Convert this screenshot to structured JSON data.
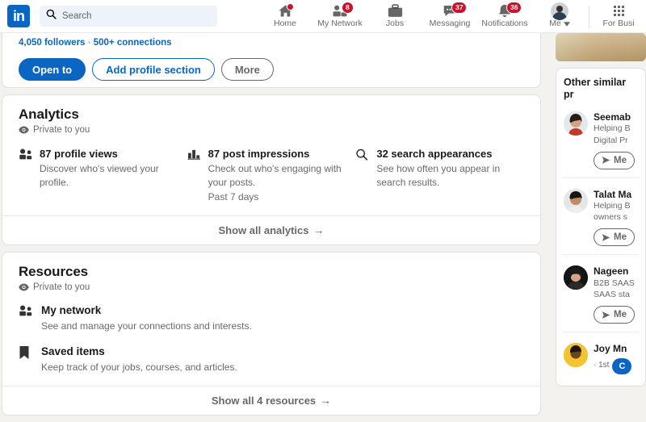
{
  "nav": {
    "logo_text": "in",
    "search_placeholder": "Search",
    "search_value": "",
    "items": [
      {
        "label": "Home",
        "icon": "home-icon",
        "badge": "",
        "badge_type": "dot"
      },
      {
        "label": "My Network",
        "icon": "network-icon",
        "badge": "8",
        "badge_type": "count"
      },
      {
        "label": "Jobs",
        "icon": "briefcase-icon",
        "badge": "",
        "badge_type": "none"
      },
      {
        "label": "Messaging",
        "icon": "message-icon",
        "badge": "37",
        "badge_type": "count"
      },
      {
        "label": "Notifications",
        "icon": "bell-icon",
        "badge": "36",
        "badge_type": "count"
      }
    ],
    "me_label": "Me",
    "business_label": "For Busi"
  },
  "profile": {
    "followers": "4,050 followers",
    "separator": "·",
    "connections": "500+ connections",
    "open_to_label": "Open to",
    "add_section_label": "Add profile section",
    "more_label": "More"
  },
  "analytics": {
    "title": "Analytics",
    "private_label": "Private to you",
    "stats": [
      {
        "icon": "people-icon",
        "title": "87 profile views",
        "desc": "Discover who's viewed your profile.",
        "meta": ""
      },
      {
        "icon": "bar-chart-icon",
        "title": "87 post impressions",
        "desc": "Check out who's engaging with your posts.",
        "meta": "Past 7 days"
      },
      {
        "icon": "search-icon",
        "title": "32 search appearances",
        "desc": "See how often you appear in search results.",
        "meta": ""
      }
    ],
    "show_all_label": "Show all analytics",
    "arrow": "→"
  },
  "resources": {
    "title": "Resources",
    "private_label": "Private to you",
    "items": [
      {
        "icon": "people-icon",
        "title": "My network",
        "desc": "See and manage your connections and interests."
      },
      {
        "icon": "bookmark-icon",
        "title": "Saved items",
        "desc": "Keep track of your jobs, courses, and articles."
      }
    ],
    "show_all_label": "Show all 4 resources",
    "arrow": "→"
  },
  "similar": {
    "heading": "Other similar pr",
    "message_label": "Me",
    "connect_label": "C",
    "people": [
      {
        "name": "Seemab",
        "line1": "Helping B",
        "line2": "Digital Pr",
        "degree": "",
        "action": "message",
        "avatar_bg": "#e3e9ee",
        "hair": "#2b1d15",
        "skin": "#d9a183",
        "shirt": "#c0392b"
      },
      {
        "name": "Talat Ma",
        "line1": "Helping B",
        "line2": "owners s",
        "degree": "",
        "action": "message",
        "avatar_bg": "#e6e6e6",
        "hair": "#181410",
        "skin": "#c08a63",
        "shirt": "#f0eeec"
      },
      {
        "name": "Nageen",
        "line1": "B2B SAAS",
        "line2": "SAAS sta",
        "degree": "",
        "action": "message",
        "avatar_bg": "#141414",
        "hair": "#1b1b1b",
        "skin": "#d6a684",
        "shirt": "#2a2a2a"
      },
      {
        "name": "Joy Mn",
        "line1": "",
        "line2": "",
        "degree": "· 1st",
        "action": "connect",
        "avatar_bg": "#f4c430",
        "hair": "#20160f",
        "skin": "#6b4423",
        "shirt": "#f4c430"
      }
    ]
  },
  "colors": {
    "brand_blue": "#0a66c2",
    "badge_red": "#cb112d",
    "page_bg": "#f4f2ee"
  }
}
